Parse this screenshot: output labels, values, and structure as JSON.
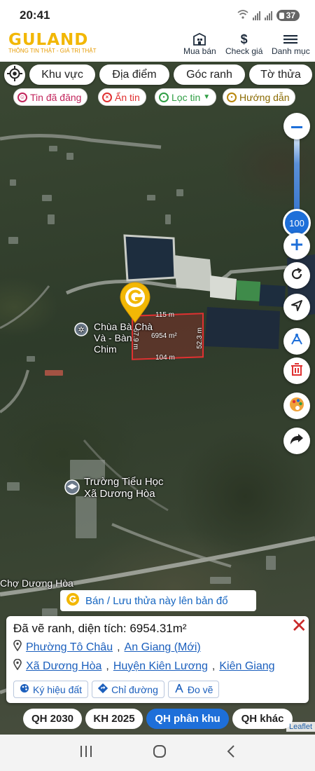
{
  "status": {
    "time": "20:41",
    "battery": "37"
  },
  "brand": {
    "name": "GULAND",
    "tagline": "THÔNG TIN THẬT - GIÁ TRỊ THẬT"
  },
  "header_nav": [
    {
      "label": "Mua bán",
      "icon": "building-icon"
    },
    {
      "label": "Check giá",
      "icon": "dollar-icon"
    },
    {
      "label": "Danh mục",
      "icon": "menu-icon"
    }
  ],
  "map_buttons": [
    "Khu vực",
    "Địa điểm",
    "Góc ranh",
    "Tờ thửa"
  ],
  "chips": [
    {
      "label": "Tin đã đăng",
      "color": "#c2255c"
    },
    {
      "label": "Ẩn tin",
      "color": "#e03131"
    },
    {
      "label": "Lọc tin",
      "color": "#2f9e44"
    },
    {
      "label": "Hướng dẫn",
      "color": "#b8860b"
    }
  ],
  "zoom": {
    "level": "100",
    "level_fraction": 0.95
  },
  "parcel": {
    "top": "115 m",
    "right": "52.3 m",
    "bottom": "104 m",
    "left": "67.9 m",
    "area": "6954 m²"
  },
  "map_labels": {
    "pagoda": "Chùa Bà Chà Và - Bàn Chim",
    "school_line1": "Trường Tiểu Học",
    "school_line2": "Xã Dương Hòa",
    "market": "Chợ Dương Hòa"
  },
  "upload_text": "Bán / Lưu thửa này lên bản đổ",
  "info": {
    "title": "Đã vẽ ranh, diện tích: 6954.31m²",
    "addr_new": [
      "Phường Tô Châu",
      "An Giang (Mới)"
    ],
    "addr_old": [
      "Xã Dương Hòa",
      "Huyện Kiên Lương",
      "Kiên Giang"
    ],
    "actions": [
      "Ký hiệu đất",
      "Chỉ đường",
      "Đo vẽ"
    ]
  },
  "plan_tabs": [
    "QH 2030",
    "KH 2025",
    "QH phân khu",
    "QH khác"
  ],
  "plan_tab_active": "QH phân khu",
  "attribution": "Leaflet"
}
